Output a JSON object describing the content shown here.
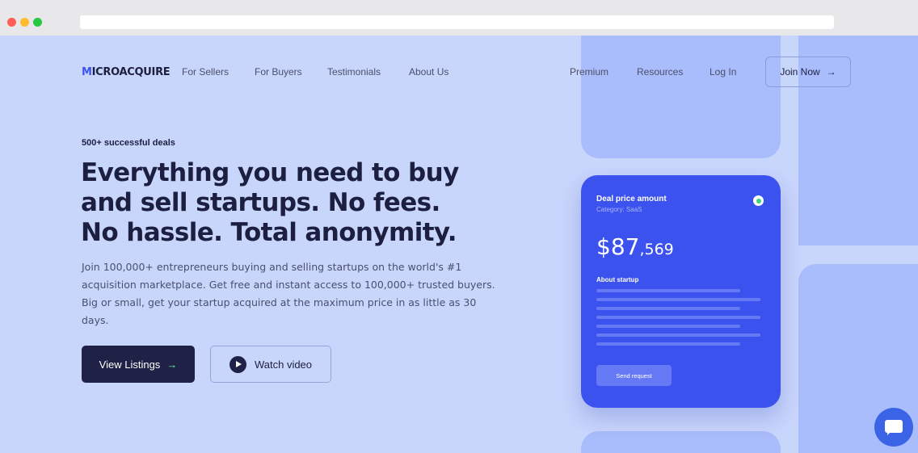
{
  "nav": {
    "logo_prefix": "M",
    "logo_rest": "ICROACQUIRE",
    "links_left": [
      "For Sellers",
      "For Buyers",
      "Testimonials",
      "About Us"
    ],
    "links_right": [
      "Premium",
      "Resources",
      "Log In"
    ],
    "join_label": "Join Now",
    "join_arrow": "→"
  },
  "hero": {
    "kicker": "500+ successful deals",
    "headline_lines": [
      "Everything you need to buy",
      "and sell startups. No fees.",
      "No hassle. Total anonymity."
    ],
    "lead_lines": [
      "Join 100,000+ entrepreneurs buying and selling startups on the world's #1",
      "acquisition marketplace. Get free and instant access to 100,000+ trusted buyers.",
      "Big or small, get your startup acquired at the maximum price in as little as 30 days."
    ],
    "primary_label": "View Listings",
    "primary_arrow": "→",
    "secondary_label": "Watch video"
  },
  "card": {
    "title": "Deal price amount",
    "category": "Category: SaaS",
    "price_main": "$87",
    "price_small": ",569",
    "about": "About startup",
    "send_label": "Send request"
  },
  "colors": {
    "page_bg": "#c9d6fc",
    "accent": "#3c52ef",
    "navy": "#1f2147",
    "success": "#3dd37a"
  },
  "icons": [
    "play-icon",
    "chat-icon",
    "status-dot-icon",
    "arrow-right-icon"
  ]
}
